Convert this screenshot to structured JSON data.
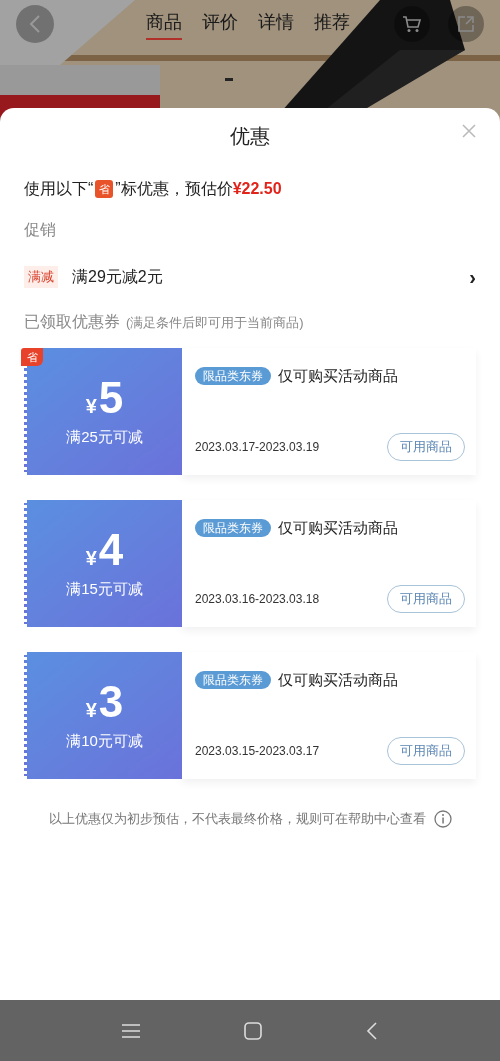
{
  "top_bar": {
    "tabs": [
      {
        "label": "商品",
        "selected": true
      },
      {
        "label": "评价",
        "selected": false
      },
      {
        "label": "详情",
        "selected": false
      },
      {
        "label": "推荐",
        "selected": false
      }
    ]
  },
  "sheet": {
    "title": "优惠",
    "summary": {
      "before": "使用以下“",
      "badge": "省",
      "after": "”标优惠，预估价",
      "price": "¥22.50"
    },
    "promo_heading": "促销",
    "promo": {
      "tag": "满减",
      "text": "满29元减2元",
      "chevron": "›"
    },
    "coupons_heading": "已领取优惠券",
    "coupons_note": "(满足条件后即可用于当前商品)",
    "coupons": [
      {
        "badge": "省",
        "currency": "¥",
        "amount": "5",
        "condition": "满25元可减",
        "tag": "限品类东券",
        "desc": "仅可购买活动商品",
        "dates": "2023.03.17-2023.03.19",
        "button": "可用商品"
      },
      {
        "currency": "¥",
        "amount": "4",
        "condition": "满15元可减",
        "tag": "限品类东券",
        "desc": "仅可购买活动商品",
        "dates": "2023.03.16-2023.03.18",
        "button": "可用商品"
      },
      {
        "currency": "¥",
        "amount": "3",
        "condition": "满10元可减",
        "tag": "限品类东券",
        "desc": "仅可购买活动商品",
        "dates": "2023.03.15-2023.03.17",
        "button": "可用商品"
      }
    ],
    "footer": "以上优惠仅为初步预估，不代表最终价格，规则可在帮助中心查看"
  }
}
